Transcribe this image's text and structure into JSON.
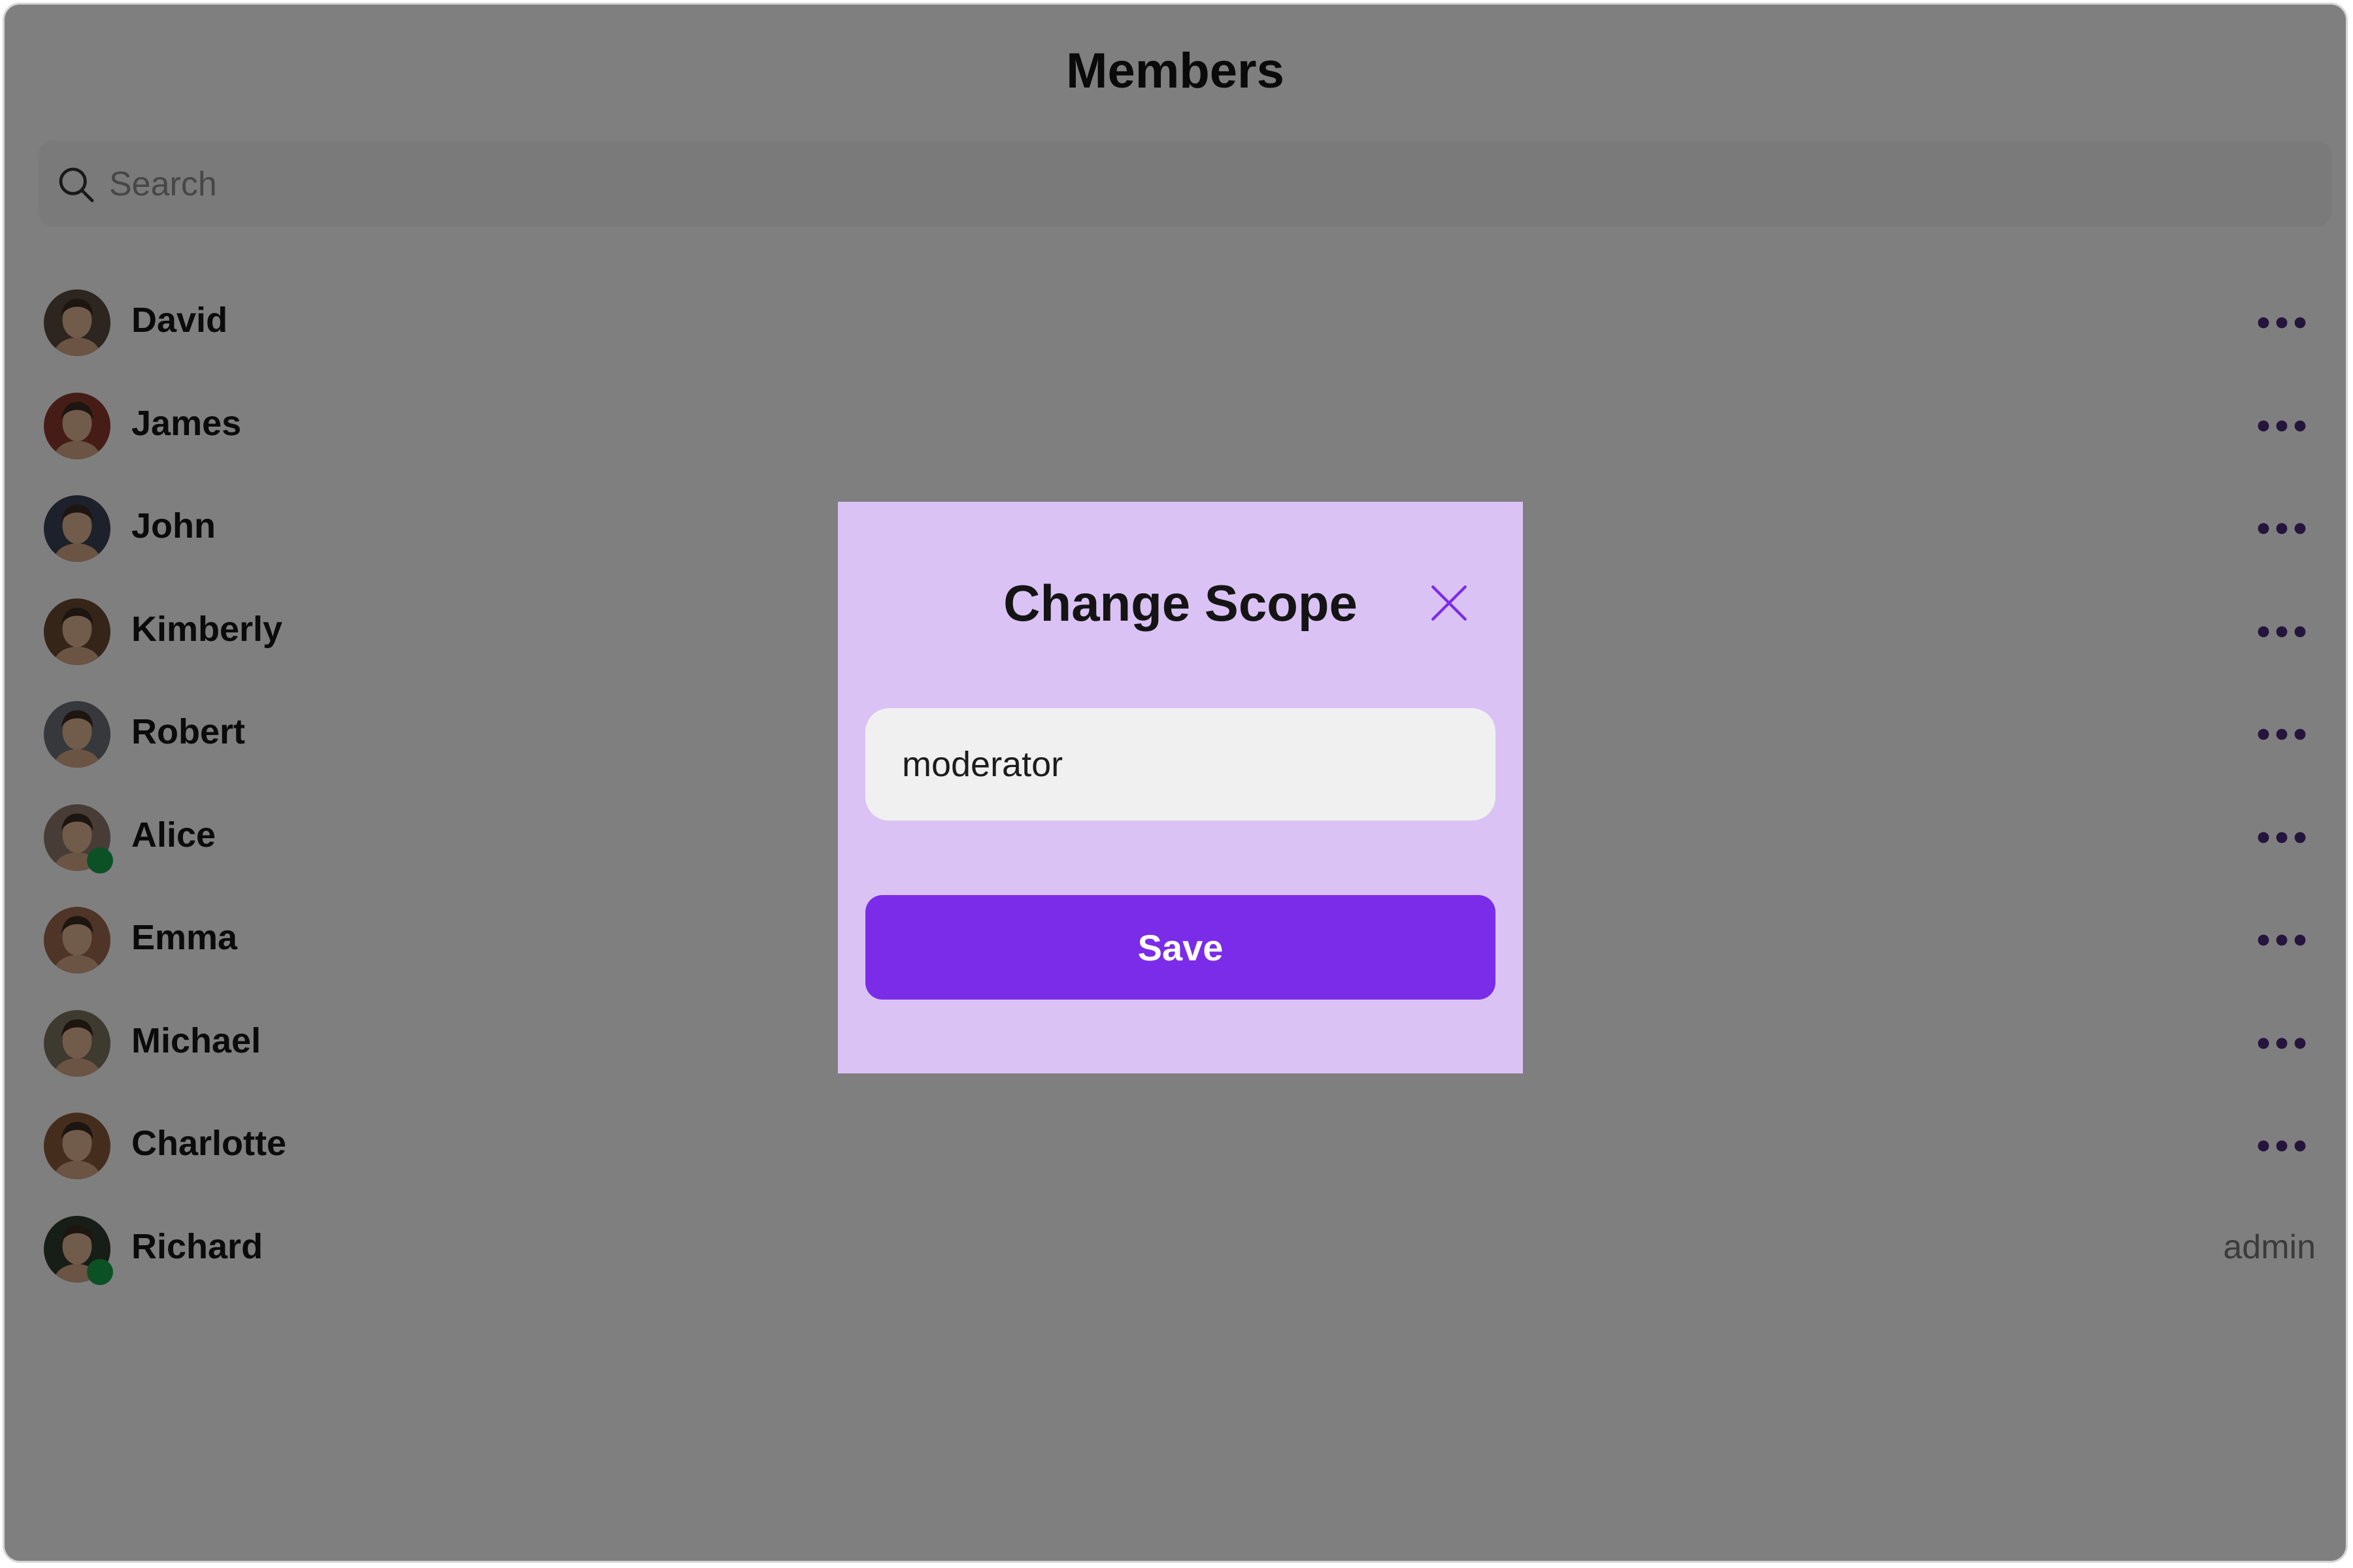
{
  "page": {
    "title": "Members"
  },
  "search": {
    "placeholder": "Search",
    "value": ""
  },
  "colors": {
    "accent": "#7b2ce9",
    "modal_background": "#dac3f4",
    "presence_online": "#16a34a",
    "more_dots": "#4b2a7a"
  },
  "icons": {
    "search": "search-icon",
    "more": "more-horizontal-icon",
    "close": "close-icon",
    "presence": "online-status-dot"
  },
  "members": [
    {
      "name": "David",
      "online": false,
      "scope": "",
      "avatar_color": "#5a4a3e"
    },
    {
      "name": "James",
      "online": false,
      "scope": "",
      "avatar_color": "#8c3a2c"
    },
    {
      "name": "John",
      "online": false,
      "scope": "",
      "avatar_color": "#3a4356"
    },
    {
      "name": "Kimberly",
      "online": false,
      "scope": "",
      "avatar_color": "#6b4a32"
    },
    {
      "name": "Robert",
      "online": false,
      "scope": "",
      "avatar_color": "#6c7078"
    },
    {
      "name": "Alice",
      "online": true,
      "scope": "",
      "avatar_color": "#8f7a6c"
    },
    {
      "name": "Emma",
      "online": false,
      "scope": "",
      "avatar_color": "#9c6b4e"
    },
    {
      "name": "Michael",
      "online": false,
      "scope": "",
      "avatar_color": "#7e7560"
    },
    {
      "name": "Charlotte",
      "online": false,
      "scope": "",
      "avatar_color": "#8a5a3c"
    },
    {
      "name": "Richard",
      "online": true,
      "scope": "admin",
      "avatar_color": "#2f3a2e"
    }
  ],
  "modal": {
    "title": "Change Scope",
    "scope_value": "moderator",
    "save_label": "Save"
  }
}
